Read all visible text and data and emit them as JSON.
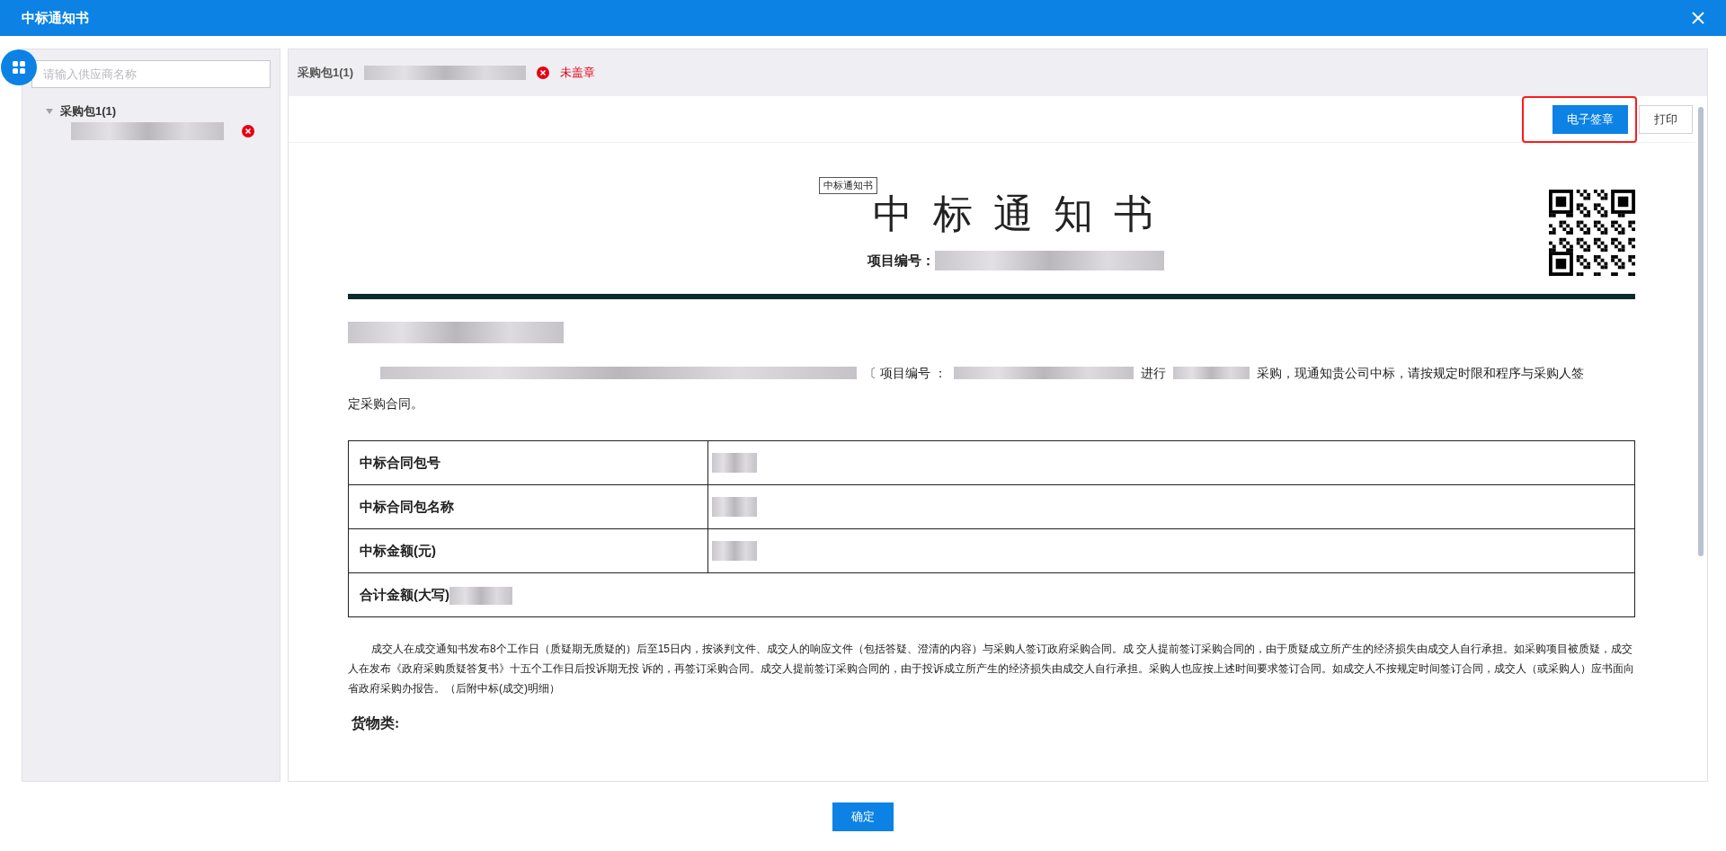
{
  "dialog": {
    "title": "中标通知书"
  },
  "sidebar": {
    "search": {
      "placeholder": "请输入供应商名称"
    },
    "tree": [
      {
        "label": "采购包1(1)",
        "expanded": true,
        "children": [
          {
            "sealed": false
          }
        ]
      }
    ]
  },
  "header": {
    "package": "采购包1(1)",
    "sealed": false,
    "status_text": "未盖章"
  },
  "toolbar": {
    "buttons": [
      {
        "label": "电子签章",
        "kind": "primary",
        "highlighted": true
      },
      {
        "label": "打印",
        "kind": "default",
        "highlighted": false
      }
    ]
  },
  "document": {
    "tooltip": "中标通知书",
    "title": "中 标 通 知 书",
    "project_label": "项目编号：",
    "paragraph": [
      "〔 项目编号 ：",
      "进行",
      "采购，现通知贵公司中标，请按规定时限和程序与采购人签",
      "定采购合同。"
    ],
    "table": [
      {
        "label": "中标合同包号",
        "kind": "split"
      },
      {
        "label": "中标合同包名称",
        "kind": "split"
      },
      {
        "label": "中标金额(元)",
        "kind": "split"
      },
      {
        "label": "合计金额(大写)",
        "kind": "span"
      }
    ],
    "notice": "成交人在成交通知书发布8个工作日（质疑期无质疑的）后至15日内，按谈判文件、成交人的响应文件（包括答疑、澄清的内容）与采购人签订政府采购合同。成 交人提前签订采购合同的，由于质疑成立所产生的经济损失由成交人自行承担。如采购项目被质疑，成交人在发布《政府采购质疑答复书》十五个工作日后投诉期无投 诉的，再签订采购合同。成交人提前签订采购合同的，由于投诉成立所产生的经济损失由成交人自行承担。采购人也应按上述时间要求签订合同。如成交人不按规定时间签订合同，成交人（或采购人）应书面向省政府采购办报告。（后附中标(成交)明细）",
    "section": "货物类:"
  },
  "footer": {
    "confirm": "确定"
  }
}
